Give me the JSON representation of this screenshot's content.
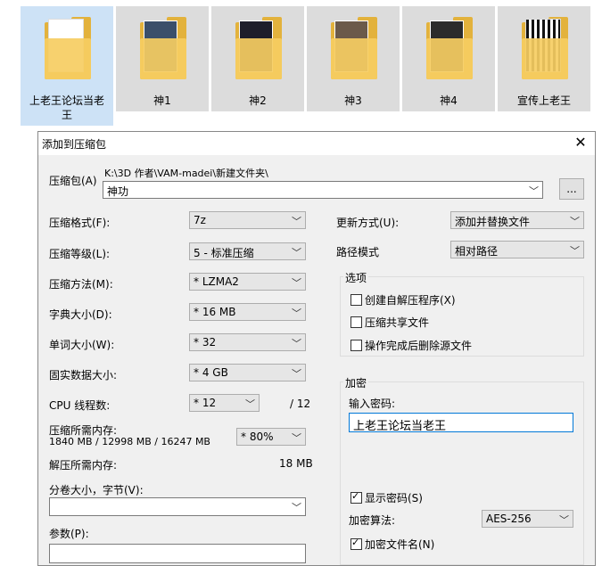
{
  "folders": [
    {
      "label": "上老王论坛当老\n王",
      "selected": true,
      "thumb": "paper"
    },
    {
      "label": "神1",
      "selected": false,
      "thumb": "photo"
    },
    {
      "label": "神2",
      "selected": false,
      "thumb": "photo"
    },
    {
      "label": "神3",
      "selected": false,
      "thumb": "photo"
    },
    {
      "label": "神4",
      "selected": false,
      "thumb": "photo"
    },
    {
      "label": "宣传上老王",
      "selected": false,
      "thumb": "qr"
    }
  ],
  "dialog": {
    "title": "添加到压缩包",
    "close_icon": "close-icon",
    "archive_label": "压缩包(A)",
    "archive_path": "K:\\3D  作者\\VAM-madei\\新建文件夹\\",
    "archive_name": "神功",
    "browse_label": "...",
    "left": {
      "format_label": "压缩格式(F):",
      "format_value": "7z",
      "level_label": "压缩等级(L):",
      "level_value": "5 - 标准压缩",
      "method_label": "压缩方法(M):",
      "method_value": "*  LZMA2",
      "dict_label": "字典大小(D):",
      "dict_value": "*  16 MB",
      "word_label": "单词大小(W):",
      "word_value": "*  32",
      "solid_label": "固实数据大小:",
      "solid_value": "*  4 GB",
      "cpu_label": "CPU 线程数:",
      "cpu_value": "*  12",
      "cpu_total": "/ 12",
      "mem_label": "压缩所需内存:",
      "mem_detail": "1840 MB / 12998 MB / 16247 MB",
      "mem_percent": "*  80%",
      "decomp_label": "解压所需内存:",
      "decomp_value": "18 MB",
      "split_label": "分卷大小，字节(V):",
      "split_value": "",
      "params_label": "参数(P):",
      "params_value": ""
    },
    "right": {
      "update_label": "更新方式(U):",
      "update_value": "添加并替换文件",
      "path_label": "路径模式",
      "path_value": "相对路径",
      "options_title": "选项",
      "opt_sfx": "创建自解压程序(X)",
      "opt_shared": "压缩共享文件",
      "opt_delete": "操作完成后删除源文件",
      "encrypt_title": "加密",
      "password_label": "输入密码:",
      "password_value": "上老王论坛当老王",
      "show_password": "显示密码(S)",
      "algo_label": "加密算法:",
      "algo_value": "AES-256",
      "encrypt_names": "加密文件名(N)"
    }
  }
}
